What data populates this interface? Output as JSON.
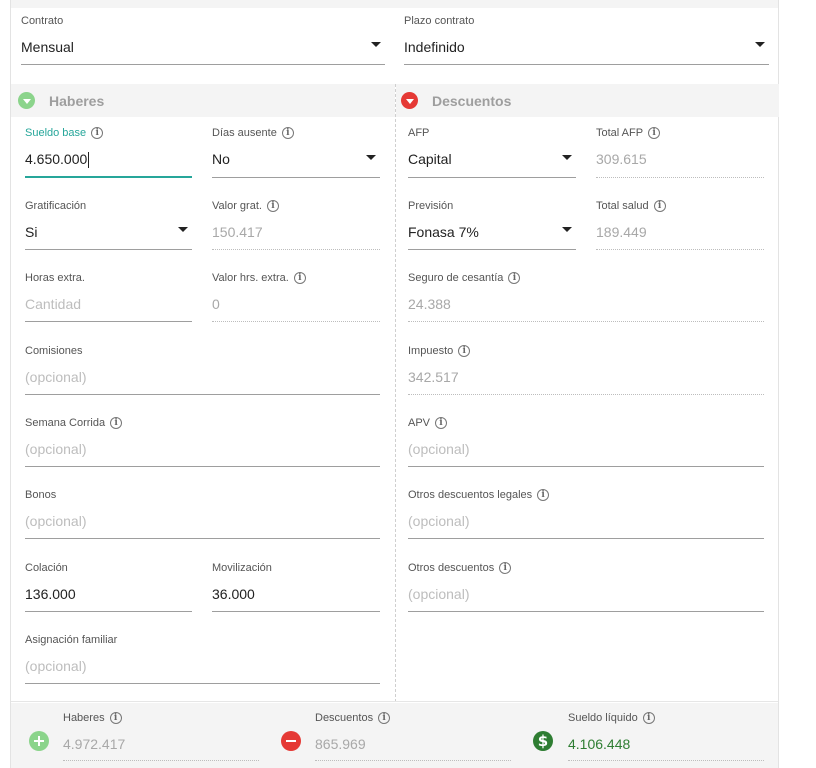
{
  "contract": {
    "contrato": {
      "label": "Contrato",
      "value": "Mensual"
    },
    "plazo": {
      "label": "Plazo contrato",
      "value": "Indefinido"
    }
  },
  "haberes": {
    "title": "Haberes",
    "sueldo_base": {
      "label": "Sueldo base",
      "value": "4.650.000"
    },
    "dias_ausente": {
      "label": "Días ausente",
      "value": "No"
    },
    "gratificacion": {
      "label": "Gratificación",
      "value": "Si"
    },
    "valor_grat": {
      "label": "Valor grat.",
      "value": "150.417"
    },
    "horas_extra": {
      "label": "Horas extra.",
      "placeholder": "Cantidad"
    },
    "valor_hrs_extra": {
      "label": "Valor hrs. extra.",
      "value": "0"
    },
    "comisiones": {
      "label": "Comisiones",
      "placeholder": "(opcional)"
    },
    "semana_corrida": {
      "label": "Semana Corrida",
      "placeholder": "(opcional)"
    },
    "bonos": {
      "label": "Bonos",
      "placeholder": "(opcional)"
    },
    "colacion": {
      "label": "Colación",
      "value": "136.000"
    },
    "movilizacion": {
      "label": "Movilización",
      "value": "36.000"
    },
    "asignacion_familiar": {
      "label": "Asignación familiar",
      "placeholder": "(opcional)"
    }
  },
  "descuentos": {
    "title": "Descuentos",
    "afp": {
      "label": "AFP",
      "value": "Capital"
    },
    "total_afp": {
      "label": "Total AFP",
      "value": "309.615"
    },
    "prevision": {
      "label": "Previsión",
      "value": "Fonasa 7%"
    },
    "total_salud": {
      "label": "Total salud",
      "value": "189.449"
    },
    "seguro_cesantia": {
      "label": "Seguro de cesantía",
      "value": "24.388"
    },
    "impuesto": {
      "label": "Impuesto",
      "value": "342.517"
    },
    "apv": {
      "label": "APV",
      "placeholder": "(opcional)"
    },
    "otros_legales": {
      "label": "Otros descuentos legales",
      "placeholder": "(opcional)"
    },
    "otros": {
      "label": "Otros descuentos",
      "placeholder": "(opcional)"
    }
  },
  "totals": {
    "haberes": {
      "label": "Haberes",
      "value": "4.972.417"
    },
    "descuentos": {
      "label": "Descuentos",
      "value": "865.969"
    },
    "liquido": {
      "label": "Sueldo líquido",
      "value": "4.106.448"
    }
  },
  "colors": {
    "accent": "#26a69a",
    "positive": "#8bd48b",
    "negative": "#e53935",
    "money": "#2e7d32"
  },
  "icons": [
    "info-icon",
    "dropdown-arrow-icon",
    "chevron-down-icon",
    "plus-circle-icon",
    "minus-circle-icon",
    "dollar-circle-icon"
  ]
}
